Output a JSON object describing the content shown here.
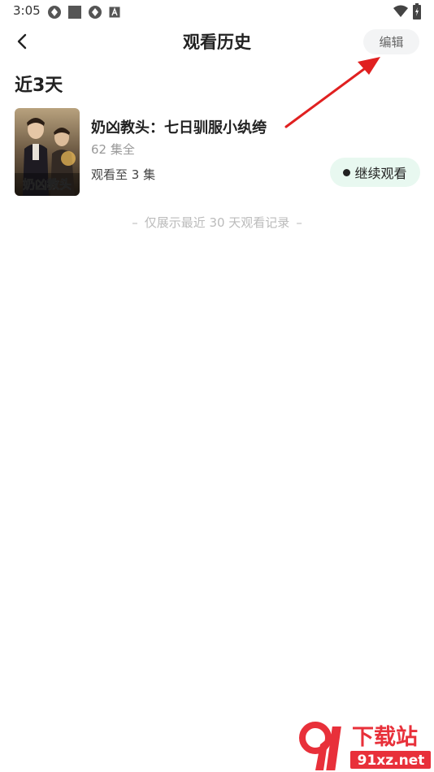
{
  "status_bar": {
    "time": "3:05"
  },
  "header": {
    "title": "观看历史",
    "edit_label": "编辑"
  },
  "section": {
    "title": "近3天"
  },
  "history": [
    {
      "title": "奶凶教头：七日驯服小纨绔",
      "episodes": "62 集全",
      "progress": "观看至 3 集",
      "continue_label": "继续观看",
      "poster_text": "奶凶教头"
    }
  ],
  "footer": {
    "dash_left": "–",
    "note": "仅展示最近 30 天观看记录",
    "dash_right": "–"
  },
  "watermark": {
    "brand": "下载站",
    "domain": "91xz.net"
  },
  "colors": {
    "continue_bg": "#e8f8f0",
    "edit_bg": "#f3f4f5",
    "annotation_arrow": "#e02020",
    "watermark_red": "#e8303a"
  }
}
